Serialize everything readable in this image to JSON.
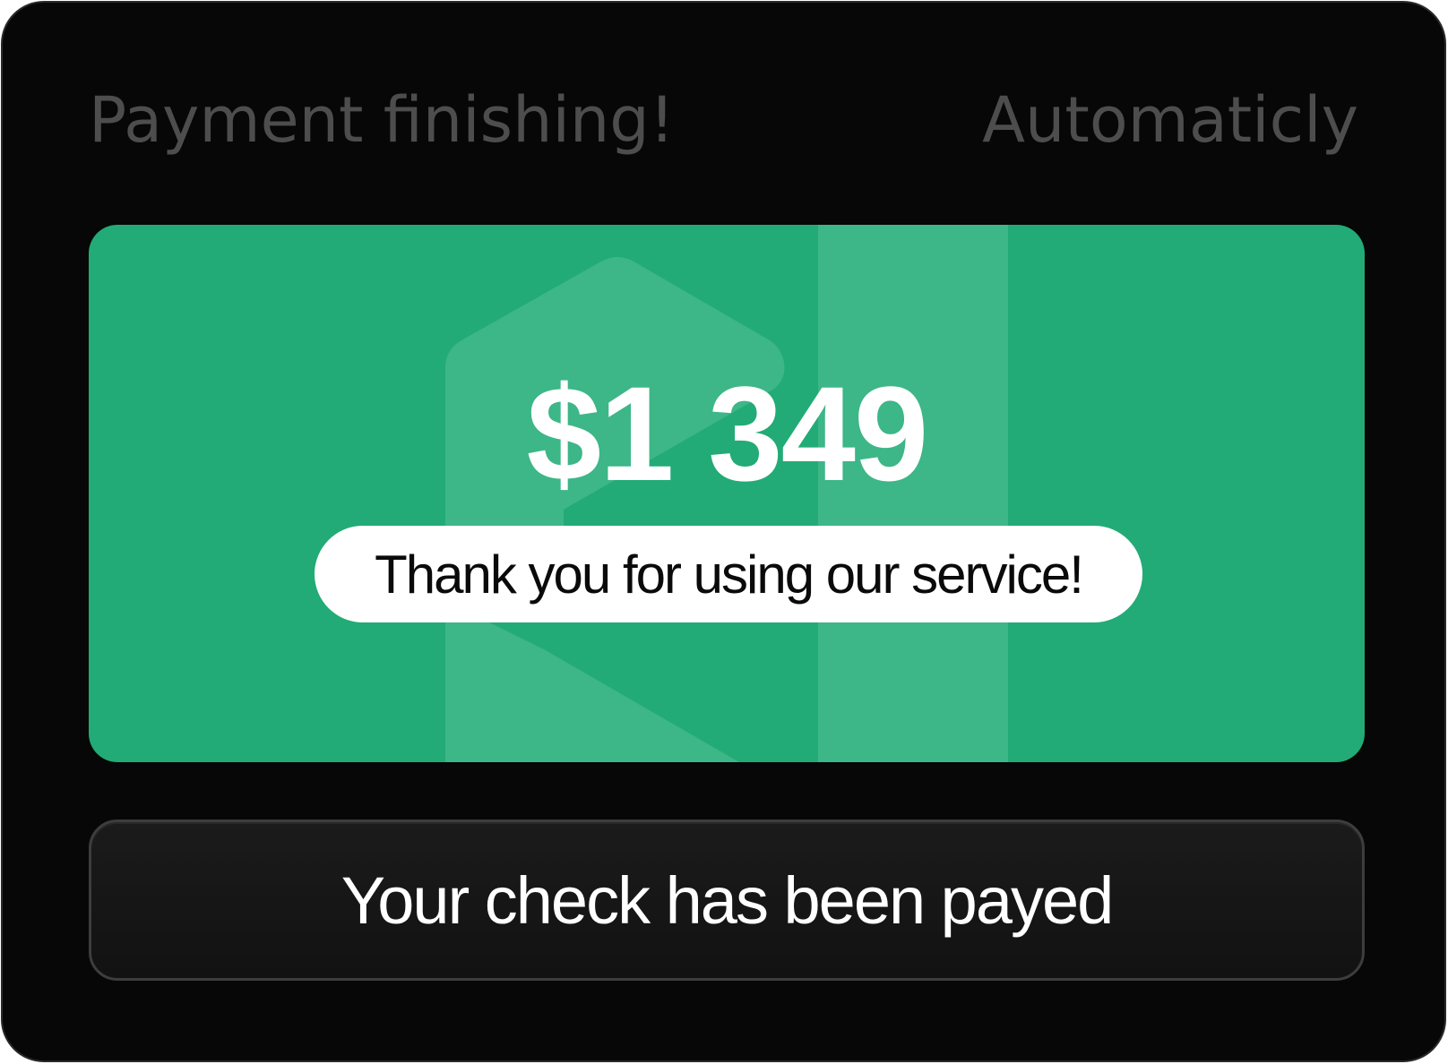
{
  "header": {
    "title": "Payment finishing!",
    "mode": "Automaticly"
  },
  "payment": {
    "amount": "$1 349",
    "message": "Thank you for using our service!"
  },
  "status": {
    "label": "Your check has been payed"
  },
  "colors": {
    "background": "#070707",
    "header_text": "#4d4d4d",
    "accent_green": "#22ab76",
    "pill_background": "#ffffff",
    "button_background": "#141414"
  },
  "icons": {
    "watermark": "shield-logo-icon"
  }
}
